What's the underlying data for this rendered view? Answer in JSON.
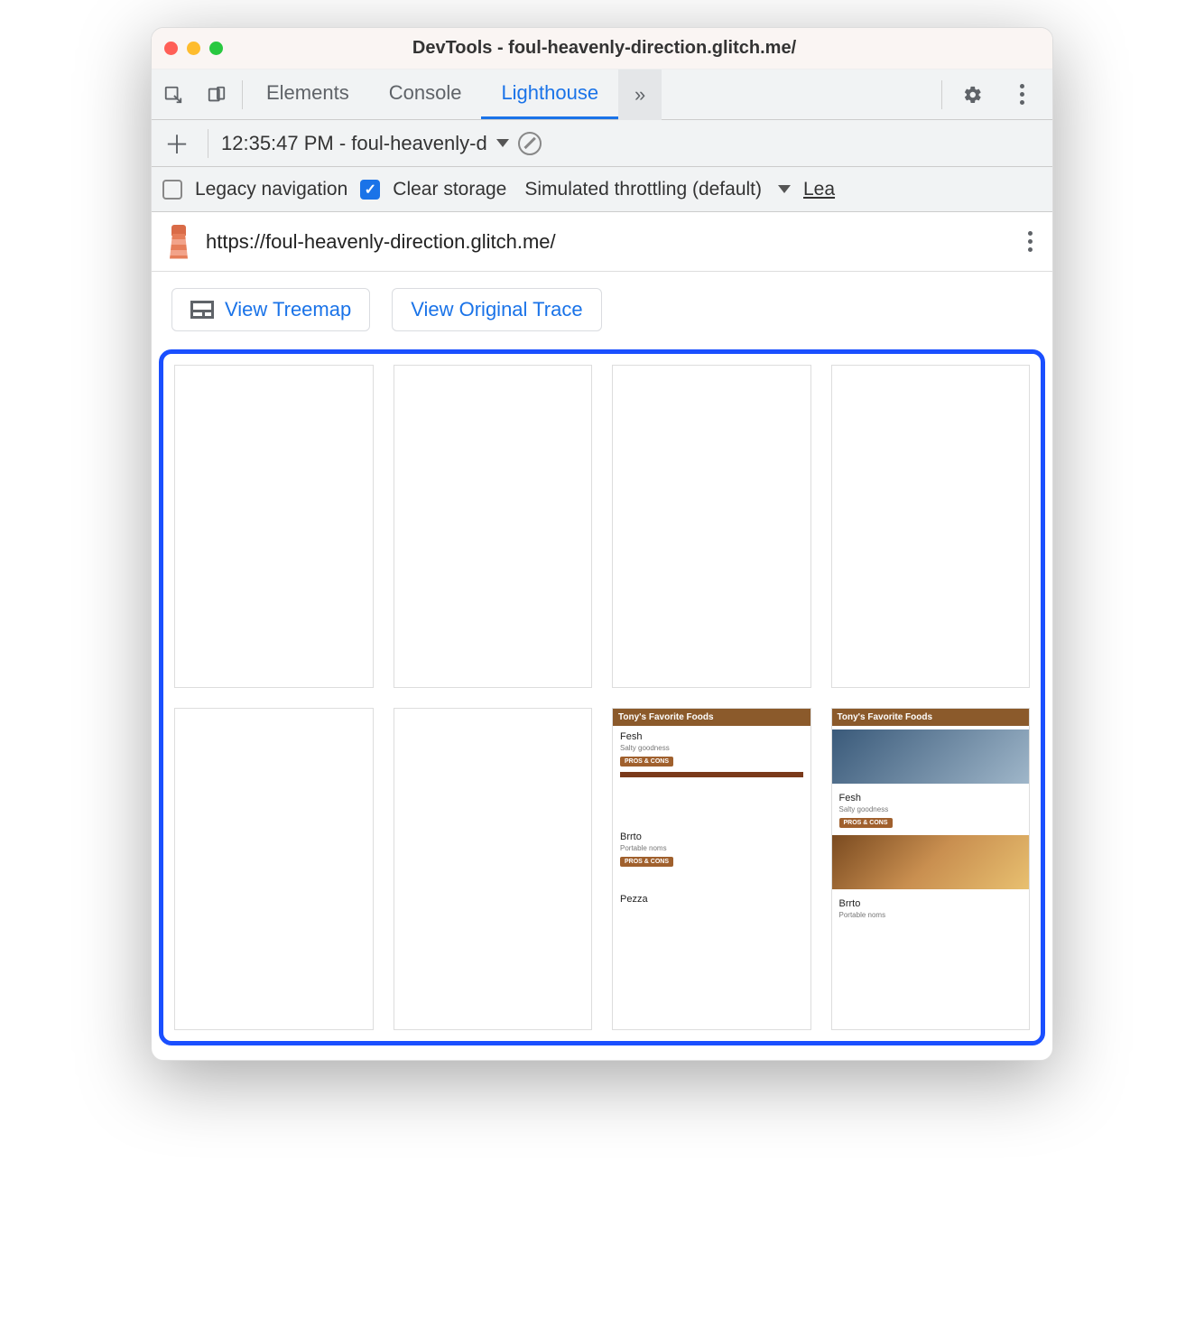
{
  "window": {
    "title": "DevTools - foul-heavenly-direction.glitch.me/"
  },
  "tabs": {
    "elements": "Elements",
    "console": "Console",
    "lighthouse": "Lighthouse"
  },
  "reportRow": {
    "label": "12:35:47 PM - foul-heavenly-d"
  },
  "options": {
    "legacy": "Legacy navigation",
    "clear": "Clear storage",
    "throttling": "Simulated throttling (default)",
    "learn": "Lea"
  },
  "url": "https://foul-heavenly-direction.glitch.me/",
  "buttons": {
    "treemap": "View Treemap",
    "trace": "View Original Trace"
  },
  "mini": {
    "header": "Tony's Favorite Foods",
    "items": [
      {
        "title": "Fesh",
        "sub": "Salty goodness",
        "btn": "PROS & CONS"
      },
      {
        "title": "Brrto",
        "sub": "Portable noms",
        "btn": "PROS & CONS"
      },
      {
        "title": "Pezza",
        "sub": "",
        "btn": ""
      }
    ]
  }
}
